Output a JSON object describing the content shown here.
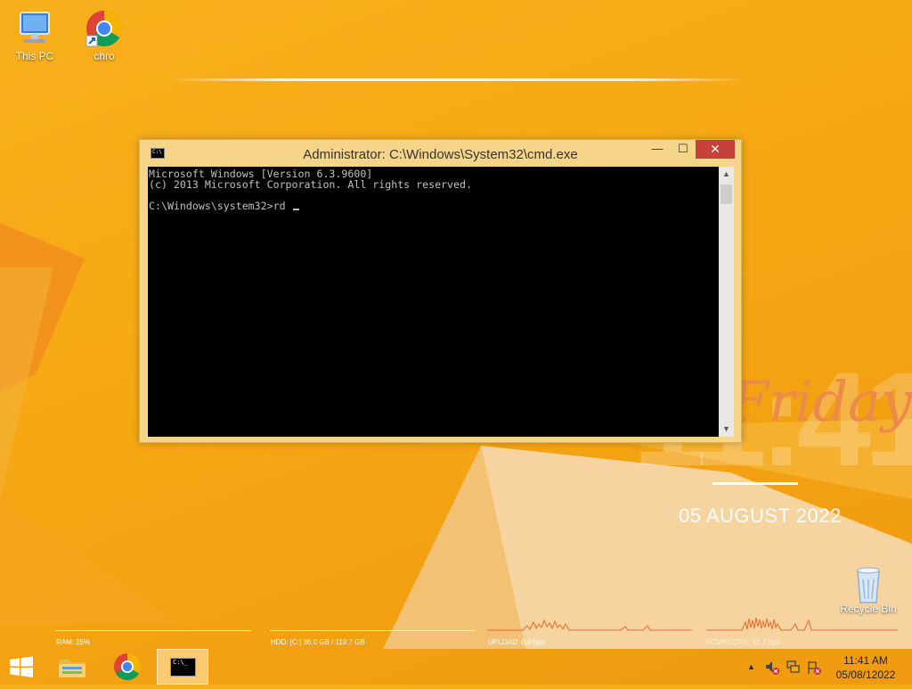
{
  "desktop": {
    "icons": [
      {
        "label": "This PC"
      },
      {
        "label": "chro"
      },
      {
        "label": "Recycle Bin"
      }
    ]
  },
  "widget": {
    "time_big": "11:41",
    "day": "Friday",
    "date": "05 AUGUST 2022"
  },
  "stats": {
    "ram": "RAM: 25%",
    "hdd": "HDD: [C:] 36.0 GB / 119.7 GB",
    "upload": "UPLOAD: 0.0 bps",
    "download": "DOWNLOAD: 92.7 bps"
  },
  "window": {
    "title": "Administrator: C:\\Windows\\System32\\cmd.exe",
    "console_lines": [
      "Microsoft Windows [Version 6.3.9600]",
      "(c) 2013 Microsoft Corporation. All rights reserved.",
      "",
      "C:\\Windows\\system32>rd "
    ],
    "buttons": {
      "minimize": "—",
      "maximize": "☐",
      "close": "✕"
    }
  },
  "taskbar": {
    "clock_time": "11:41 AM",
    "clock_date": "05/08/12022",
    "tray_chevron": "▲"
  },
  "colors": {
    "desktop_bg": "#f6a914",
    "titlebar": "#f6d58a",
    "close_button": "#c7413a",
    "console_bg": "#000000",
    "console_text": "#c0c0c0"
  }
}
